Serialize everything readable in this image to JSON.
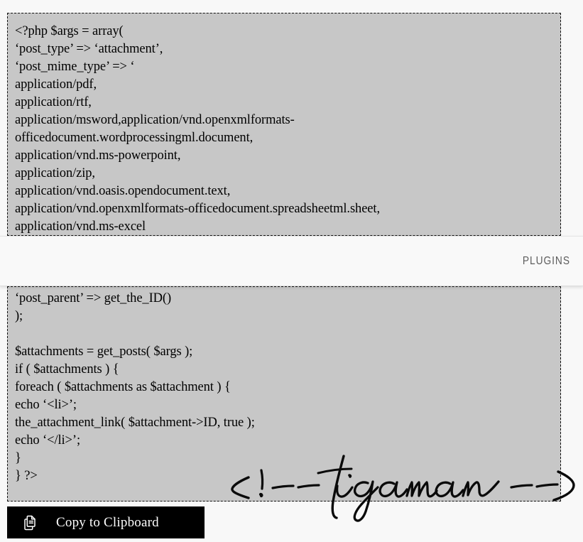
{
  "page": {
    "background_color": "#f8f8f8",
    "code_block_color": "#c7c7c7",
    "accent_color": "#000000"
  },
  "code_block_top": {
    "lines": [
      "<?php $args = array(",
      "‘post_type’ => ‘attachment’,",
      "‘post_mime_type’ => ‘",
      "application/pdf,",
      "application/rtf,",
      "application/msword,application/vnd.openxmlformats-",
      "officedocument.wordprocessingml.document,",
      "application/vnd.ms-powerpoint,",
      "application/zip,",
      "application/vnd.oasis.opendocument.text,",
      "application/vnd.openxmlformats-officedocument.spreadsheetml.sheet,",
      "application/vnd.ms-excel"
    ]
  },
  "code_block_bottom": {
    "lines": [
      "‘post_parent’ => get_the_ID()",
      ");",
      "",
      "$attachments = get_posts( $args );",
      "if ( $attachments ) {",
      "foreach ( $attachments as $attachment ) {",
      "echo ‘<li>’;",
      "the_attachment_link( $attachment->ID, true );",
      "echo ‘</li>’;",
      "}",
      "} ?>"
    ]
  },
  "plugins_bar": {
    "label": "PLUGINS"
  },
  "watermark": {
    "text": "<!-- tigaman -->",
    "color": "#000000"
  },
  "copy_button": {
    "label": "Copy to Clipboard",
    "icon": "copy-documents-icon"
  }
}
